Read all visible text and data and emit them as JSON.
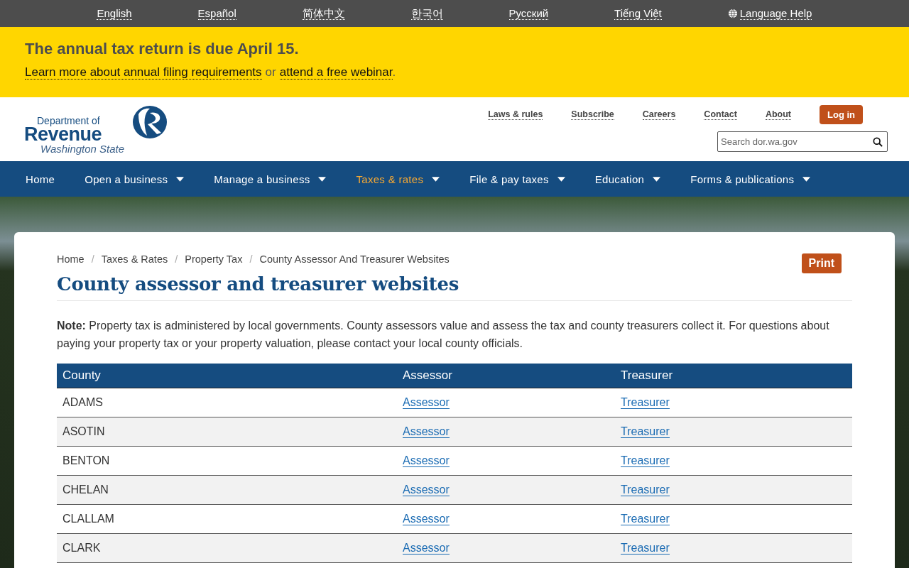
{
  "language_bar": {
    "languages": [
      "English",
      "Español",
      "简体中文",
      "한국어",
      "Русский",
      "Tiếng Việt"
    ],
    "help": "Language Help"
  },
  "alert": {
    "title": "The annual tax return is due April 15.",
    "link_1": "Learn more about annual filing requirements",
    "joiner": "or",
    "link_2": "attend a free webinar",
    "end": "."
  },
  "header": {
    "logo": {
      "line_1": "Department of",
      "line_2": "Revenue",
      "line_3": "Washington State"
    },
    "utility_links": [
      "Laws & rules",
      "Subscribe",
      "Careers",
      "Contact",
      "About"
    ],
    "login": "Log in",
    "search": {
      "placeholder": "Search dor.wa.gov"
    }
  },
  "nav": [
    {
      "label": "Home",
      "dropdown": false,
      "selected": false
    },
    {
      "label": "Open a business",
      "dropdown": true,
      "selected": false
    },
    {
      "label": "Manage a business",
      "dropdown": true,
      "selected": false
    },
    {
      "label": "Taxes & rates",
      "dropdown": true,
      "selected": true
    },
    {
      "label": "File & pay taxes",
      "dropdown": true,
      "selected": false
    },
    {
      "label": "Education",
      "dropdown": true,
      "selected": false
    },
    {
      "label": "Forms & publications",
      "dropdown": true,
      "selected": false
    }
  ],
  "breadcrumb": {
    "separator": "/",
    "items": [
      "Home",
      "Taxes & Rates",
      "Property Tax",
      "County Assessor And Treasurer Websites"
    ]
  },
  "print": "Print",
  "title": "County assessor and treasurer websites",
  "note": "**Note:** Property tax is administered by local governments. County assessors value and assess the tax and county treasurers collect it. For questions about paying your property tax or your property valuation, please contact your local county officials.",
  "table": {
    "columns": [
      "County",
      "Assessor",
      "Treasurer"
    ],
    "rows": [
      {
        "county": "ADAMS",
        "assessor": "Assessor",
        "treasurer": "Treasurer"
      },
      {
        "county": "ASOTIN",
        "assessor": "Assessor",
        "treasurer": "Treasurer"
      },
      {
        "county": "BENTON",
        "assessor": "Assessor",
        "treasurer": "Treasurer"
      },
      {
        "county": "CHELAN",
        "assessor": "Assessor",
        "treasurer": "Treasurer"
      },
      {
        "county": "CLALLAM",
        "assessor": "Assessor",
        "treasurer": "Treasurer"
      },
      {
        "county": "CLARK",
        "assessor": "Assessor",
        "treasurer": "Treasurer"
      }
    ]
  }
}
